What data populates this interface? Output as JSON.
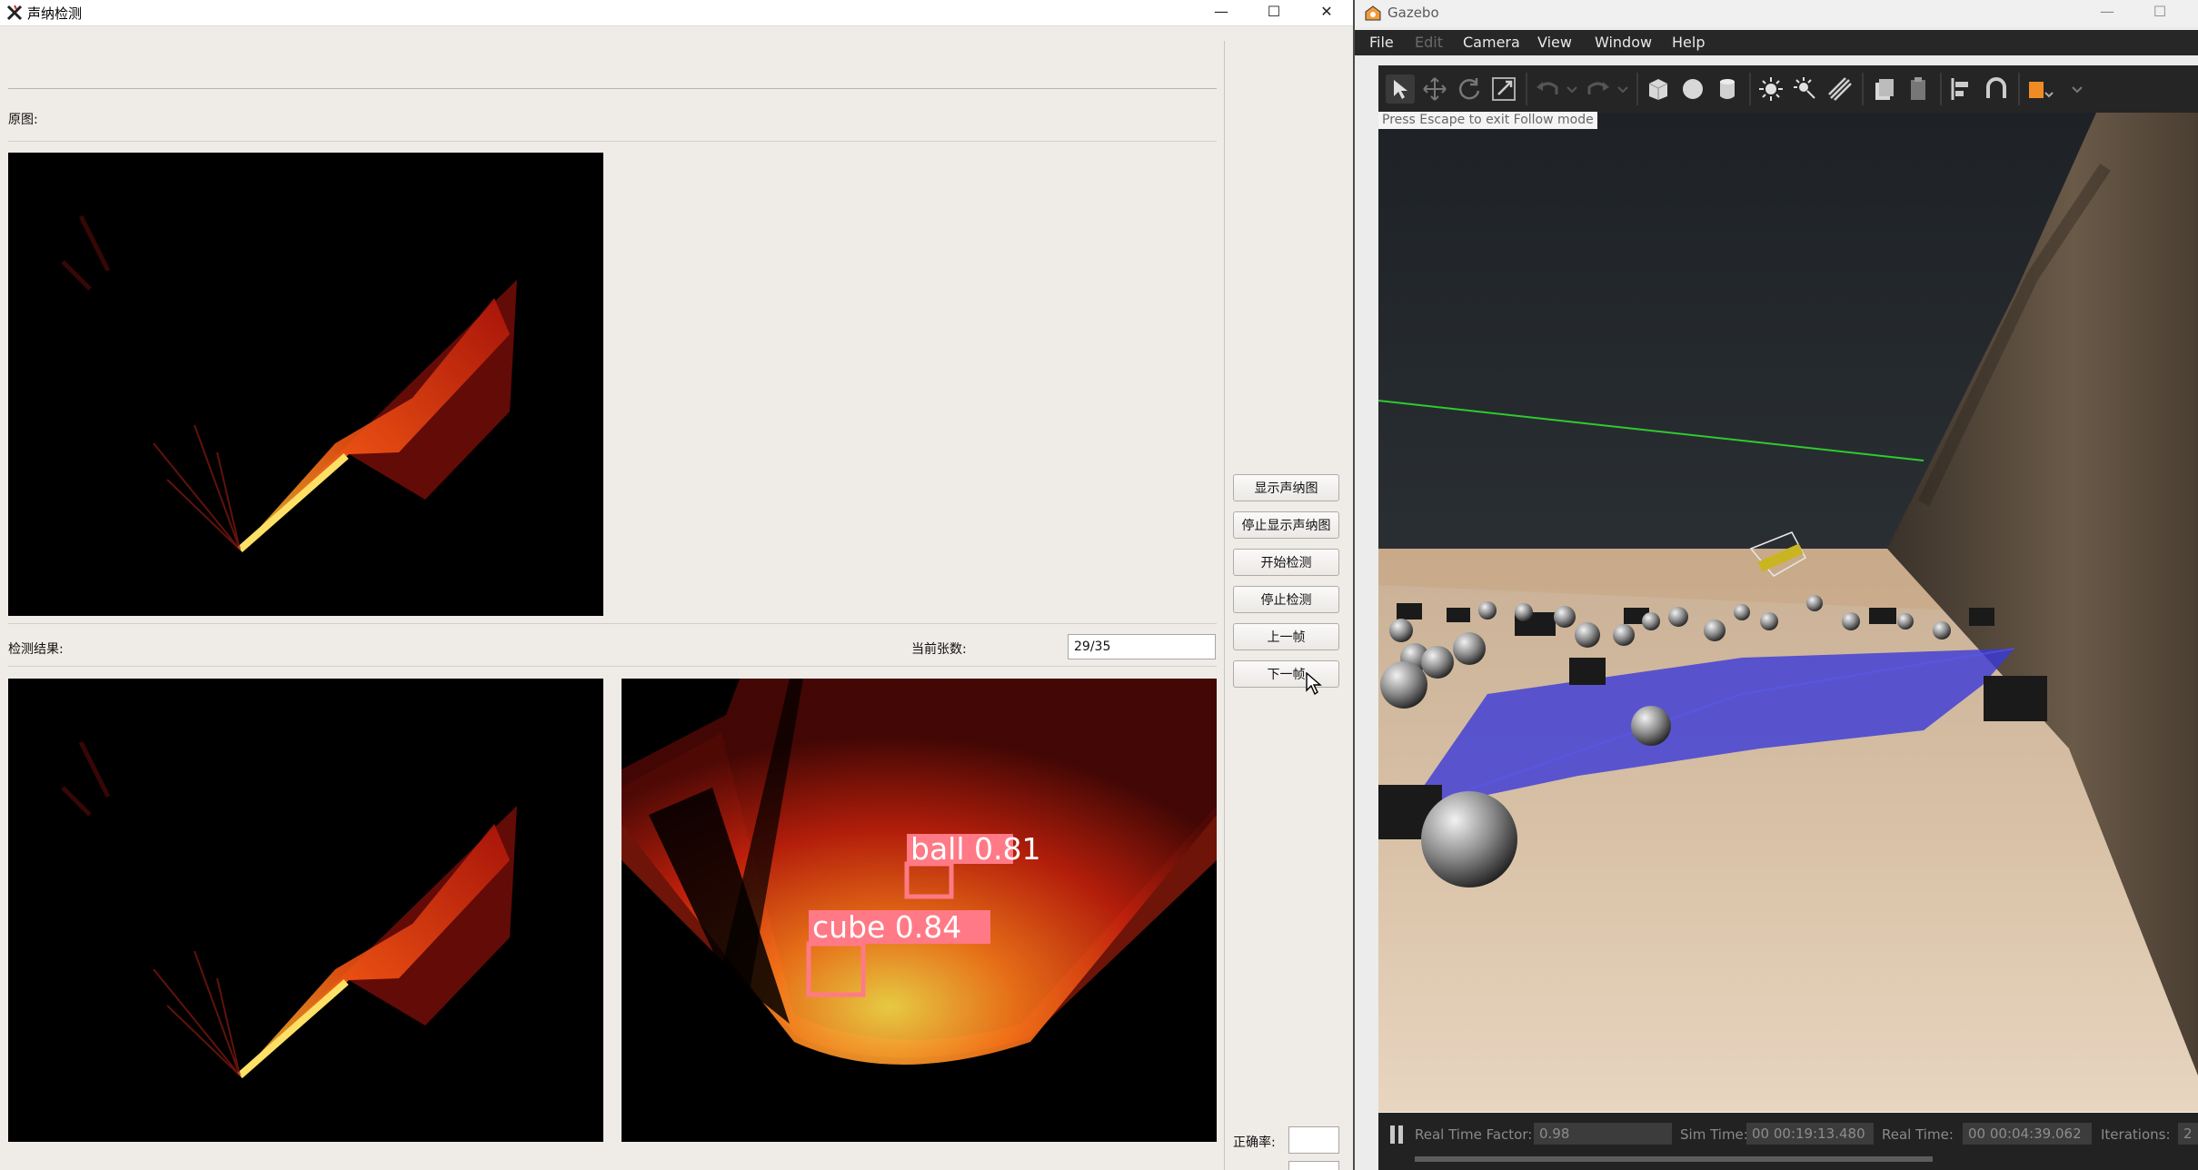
{
  "sonar_window": {
    "title": "声纳检测",
    "original_label": "原图:",
    "result_label": "检测结果:",
    "count_label": "当前张数:",
    "count_value": "29/35",
    "buttons": {
      "show_sonar": "显示声纳图",
      "stop_show_sonar": "停止显示声纳图",
      "start_detect": "开始检测",
      "stop_detect": "停止检测",
      "prev_frame": "上一帧",
      "next_frame": "下一帧"
    },
    "accuracy_label": "正确率:",
    "accuracy_value": "",
    "detections": [
      {
        "label": "ball",
        "score": "0.81",
        "text": "ball 0.81"
      },
      {
        "label": "cube",
        "score": "0.84",
        "text": "cube 0.84"
      }
    ],
    "colors": {
      "box": "#ff5a6e",
      "label_bg": "#ff7a86"
    }
  },
  "gazebo_window": {
    "title": "Gazebo",
    "menu": {
      "file": "File",
      "edit": "Edit",
      "camera": "Camera",
      "view": "View",
      "window": "Window",
      "help": "Help"
    },
    "toolbar_icons": [
      "select-arrow-icon",
      "translate-icon",
      "rotate-icon",
      "scale-icon",
      "undo-icon",
      "undo-dropdown-icon",
      "redo-icon",
      "redo-dropdown-icon",
      "box-icon",
      "sphere-icon",
      "cylinder-icon",
      "sun-light-icon",
      "point-light-icon",
      "spot-light-icon",
      "copy-icon",
      "paste-icon",
      "align-icon",
      "snap-icon",
      "view-angle-icon"
    ],
    "viewport_hint": "Press Escape to exit Follow mode",
    "status": {
      "real_time_factor_label": "Real Time Factor:",
      "real_time_factor_value": "0.98",
      "sim_time_label": "Sim Time:",
      "sim_time_value": "00 00:19:13.480",
      "real_time_label": "Real Time:",
      "real_time_value": "00 00:04:39.062",
      "iterations_label": "Iterations:",
      "iterations_value": "2"
    }
  }
}
